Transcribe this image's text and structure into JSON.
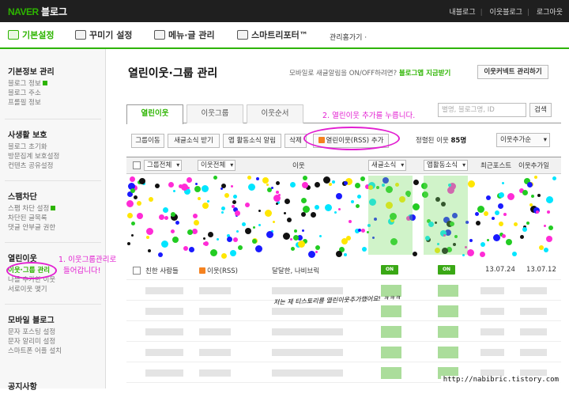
{
  "topbar": {
    "logo_naver": "NAVER",
    "logo_blog": "블로그",
    "links": [
      "내블로그",
      "이웃블로그",
      "로그아웃"
    ]
  },
  "menubar": {
    "items": [
      "기본설정",
      "꾸미기 설정",
      "메뉴·글 관리",
      "스마트리포터™"
    ],
    "home_link": "관리홈가기 ·"
  },
  "sidebar": {
    "groups": [
      {
        "title": "기본정보 관리",
        "items": [
          "블로그 정보",
          "블로그 주소",
          "프롤필 정보"
        ]
      },
      {
        "title": "사생활 보호",
        "items": [
          "블로그 초기화",
          "방문집계 보호설정",
          "컨텐츠 공유설정"
        ]
      },
      {
        "title": "스팸차단",
        "items": [
          "스팸 차단 설정",
          "차단된 글목록",
          "댓글 안부글 권한"
        ]
      },
      {
        "title": "열린이웃",
        "items": [
          "이웃·그룹 관리",
          "나를 추가한 이웃",
          "서로이웃 맺기"
        ]
      },
      {
        "title": "모바일 블로그",
        "items": [
          "문자 포스팅 설정",
          "문자 알리미 설정",
          "스마트폰 어플 설치"
        ]
      },
      {
        "title": "공지사항",
        "items": []
      }
    ]
  },
  "main": {
    "title": "열린이웃·그룹 관리",
    "notice_pre": "모바일로 새글알림을 ON/OFF하려면?",
    "notice_link": "블로그앱 지금받기",
    "kakao_btn": "이웃커넥트 관리하기",
    "tabs": [
      "열린이웃",
      "이웃그룹",
      "이웃순서"
    ],
    "search_placeholder": "별명, 블로그명, ID",
    "search_btn": "검색",
    "toolbar": [
      "그룹이동",
      "새글소식 받기",
      "앱 활동소식 알림",
      "삭제",
      "열린이웃(RSS) 추가"
    ],
    "sort_info_pre": "정렬된 이웃",
    "sort_info_count": "85명",
    "sort_select": "이웃추가순",
    "columns": [
      "그룹전체",
      "이웃전체",
      "이웃",
      "새글소식",
      "앱활동소식",
      "최근포스트",
      "이웃추가일"
    ],
    "row": {
      "group": "친한 사람들",
      "type": "이웃(RSS)",
      "name": "달달한, 나비브릭",
      "newpost": "ON",
      "app": "ON",
      "recent": "13.07.24",
      "added": "13.07.12"
    }
  },
  "annotations": {
    "step1_line1": "1. 이웃그룹관리로",
    "step1_line2": "들어갑니다!",
    "step2": "2. 열린이웃 추가를 누릅니다.",
    "handwriting": "저는 제 티스토리를 열린이웃추가했어요! ㅋㅋㅋ",
    "watermark": "http://nabibric.tistory.com",
    "color": "#e21fd1"
  }
}
